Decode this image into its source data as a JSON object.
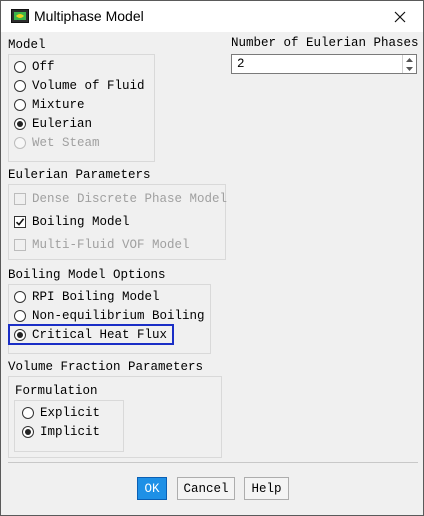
{
  "window": {
    "title": "Multiphase Model"
  },
  "model": {
    "label": "Model",
    "options": [
      {
        "label": "Off",
        "selected": false,
        "disabled": false
      },
      {
        "label": "Volume of Fluid",
        "selected": false,
        "disabled": false
      },
      {
        "label": "Mixture",
        "selected": false,
        "disabled": false
      },
      {
        "label": "Eulerian",
        "selected": true,
        "disabled": false
      },
      {
        "label": "Wet Steam",
        "selected": false,
        "disabled": true
      }
    ]
  },
  "phases": {
    "label": "Number of Eulerian Phases",
    "value": "2"
  },
  "eulerian_params": {
    "label": "Eulerian Parameters",
    "options": [
      {
        "label": "Dense Discrete Phase Model",
        "checked": false,
        "disabled": true
      },
      {
        "label": "Boiling Model",
        "checked": true,
        "disabled": false
      },
      {
        "label": "Multi-Fluid VOF Model",
        "checked": false,
        "disabled": true
      }
    ]
  },
  "boiling_options": {
    "label": "Boiling Model Options",
    "options": [
      {
        "label": "RPI Boiling Model",
        "selected": false
      },
      {
        "label": "Non-equilibrium Boiling",
        "selected": false
      },
      {
        "label": "Critical Heat Flux",
        "selected": true
      }
    ]
  },
  "volume_fraction": {
    "label": "Volume Fraction Parameters",
    "formulation_label": "Formulation",
    "options": [
      {
        "label": "Explicit",
        "selected": false
      },
      {
        "label": "Implicit",
        "selected": true
      }
    ]
  },
  "buttons": {
    "ok": "OK",
    "cancel": "Cancel",
    "help": "Help"
  },
  "colors": {
    "accent": "#1e90e6",
    "highlight_border": "#1a2ec6"
  },
  "icons": {
    "app": "multiphase-app-icon",
    "close": "close-icon",
    "spin_up": "arrow-up-icon",
    "spin_down": "arrow-down-icon",
    "check": "checkmark-icon"
  }
}
